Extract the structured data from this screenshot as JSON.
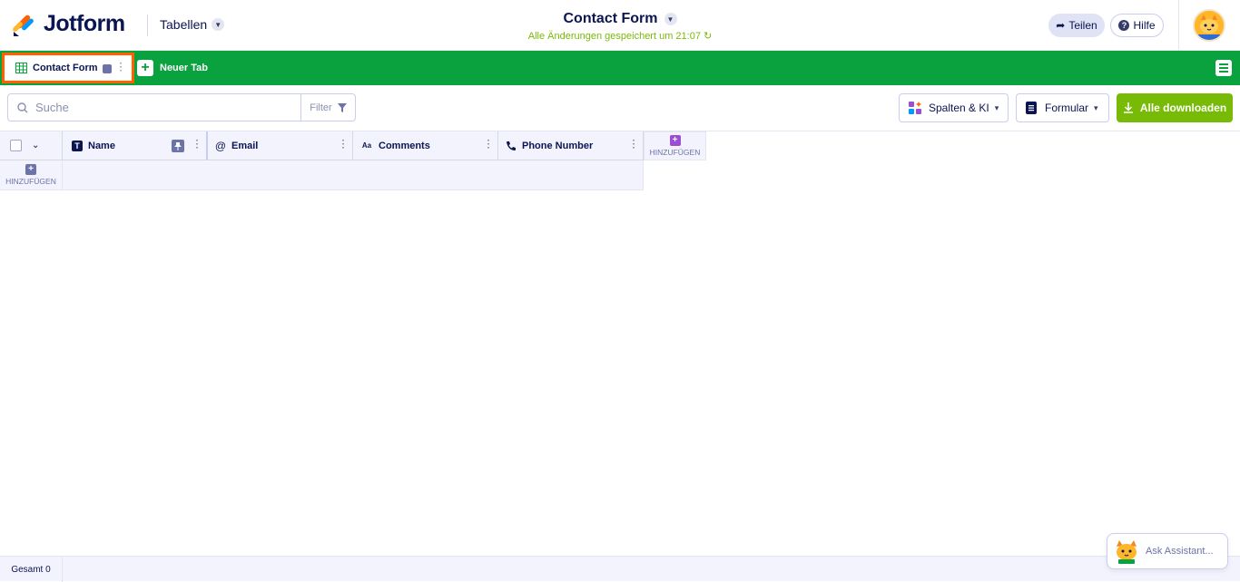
{
  "header": {
    "logo_text": "Jotform",
    "section_label": "Tabellen",
    "form_title": "Contact Form",
    "saved_status": "Alle Änderungen gespeichert um 21:07",
    "share_label": "Teilen",
    "help_label": "Hilfe"
  },
  "tabbar": {
    "active_tab_label": "Contact Form",
    "new_tab_label": "Neuer Tab"
  },
  "toolbar": {
    "search_placeholder": "Suche",
    "filter_label": "Filter",
    "columns_label": "Spalten & KI",
    "form_label": "Formular",
    "download_label": "Alle downloaden"
  },
  "grid": {
    "columns": [
      {
        "label": "Name",
        "type_icon": "text-type-icon"
      },
      {
        "label": "Email",
        "type_icon": "at-icon"
      },
      {
        "label": "Comments",
        "type_icon": "aa-icon"
      },
      {
        "label": "Phone Number",
        "type_icon": "phone-icon"
      }
    ],
    "add_column_label": "HINZUFÜGEN",
    "add_row_label": "HINZUFÜGEN"
  },
  "footer": {
    "total_label": "Gesamt 0"
  },
  "assistant": {
    "label": "Ask Assistant..."
  },
  "colors": {
    "brand_green": "#09a23e",
    "highlight_orange": "#ff6100",
    "download_green": "#78bb07",
    "navy": "#0a1551",
    "purple": "#9c4dd3"
  }
}
